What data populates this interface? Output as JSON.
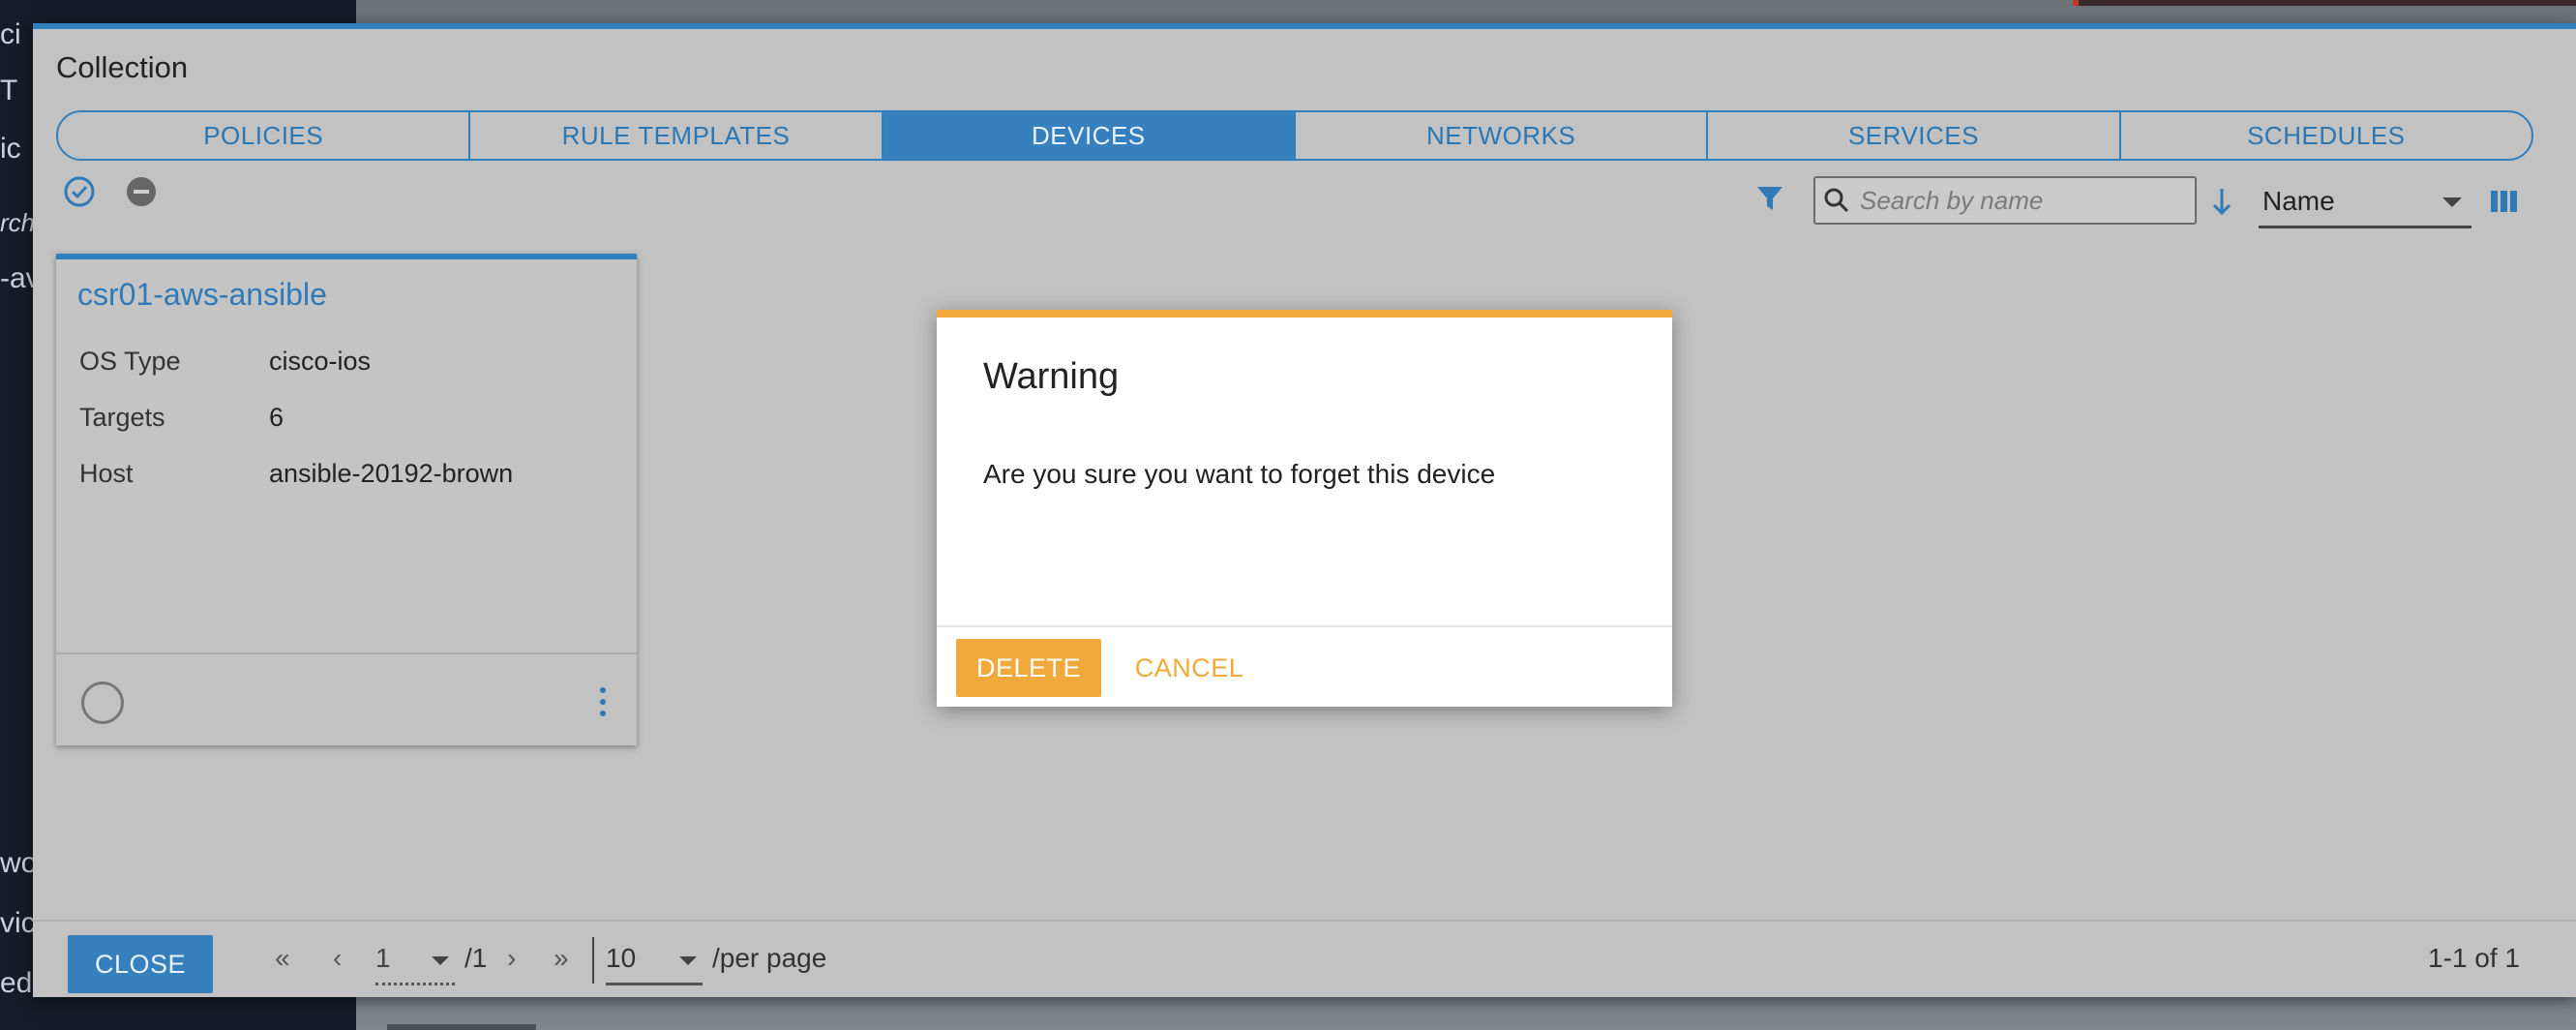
{
  "background": {
    "left_fragments": [
      "ci",
      "T",
      "ic",
      "rch",
      "-av",
      "wo",
      "vic",
      "ed"
    ]
  },
  "collection": {
    "title": "Collection",
    "tabs": [
      {
        "label": "POLICIES",
        "active": false
      },
      {
        "label": "RULE TEMPLATES",
        "active": false
      },
      {
        "label": "DEVICES",
        "active": true
      },
      {
        "label": "NETWORKS",
        "active": false
      },
      {
        "label": "SERVICES",
        "active": false
      },
      {
        "label": "SCHEDULES",
        "active": false
      }
    ],
    "toolbar": {
      "search_placeholder": "Search by name",
      "sort_field": "Name"
    },
    "device": {
      "name": "csr01-aws-ansible",
      "rows": [
        {
          "key": "OS Type",
          "value": "cisco-ios"
        },
        {
          "key": "Targets",
          "value": "6"
        },
        {
          "key": "Host",
          "value": "ansible-20192-brown"
        }
      ]
    },
    "footer": {
      "close_label": "CLOSE",
      "page_first": "«",
      "page_prev": "‹",
      "page_current": "1",
      "page_total": "/1",
      "page_next": "›",
      "page_last": "»",
      "page_size": "10",
      "per_page_label": "/per page",
      "range_label": "1-1 of 1"
    }
  },
  "warning": {
    "title": "Warning",
    "message": "Are you sure you want to forget this device",
    "delete_label": "DELETE",
    "cancel_label": "CANCEL"
  },
  "colors": {
    "accent_blue": "#2f80bf",
    "warning_orange": "#f0a93a"
  }
}
